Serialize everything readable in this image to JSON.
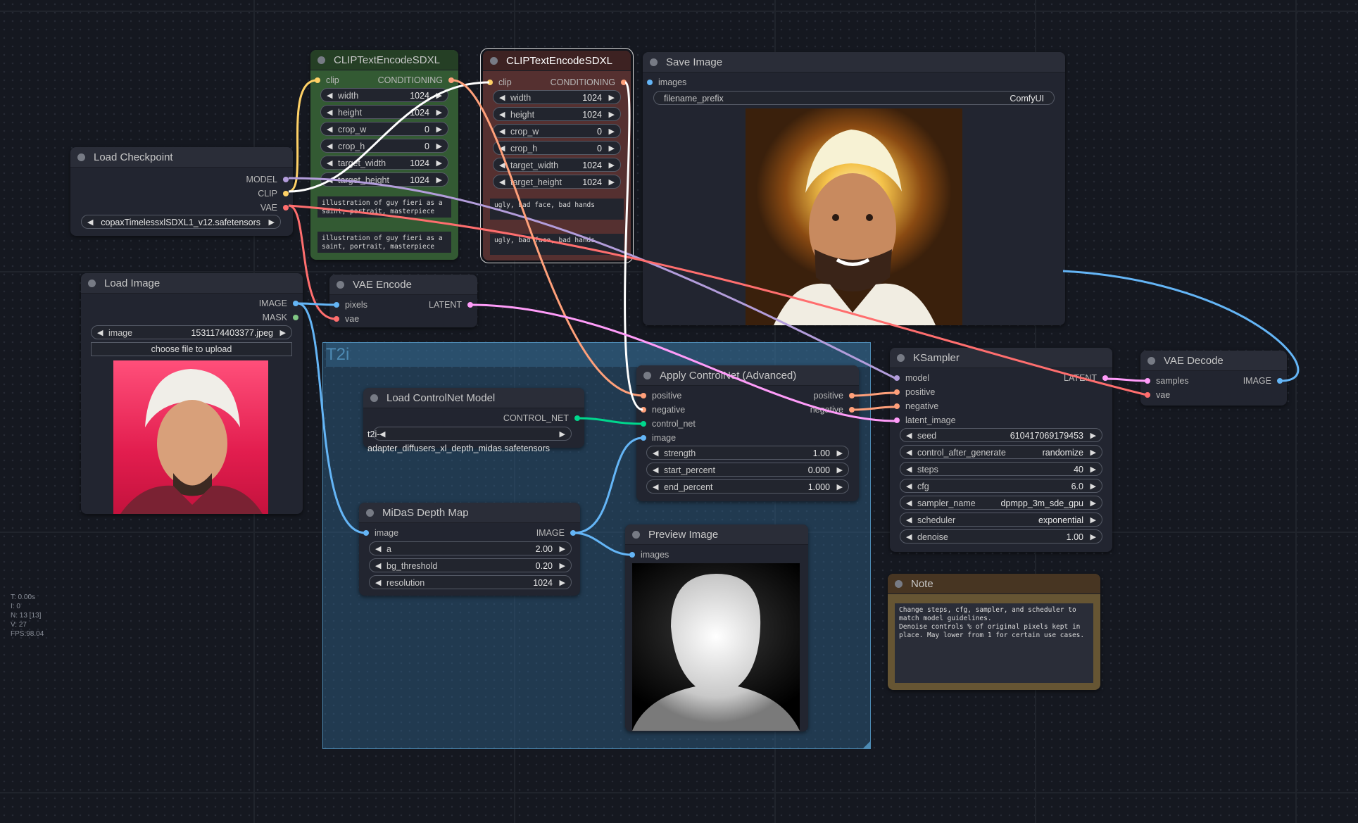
{
  "colors": {
    "model": "#b39ddb",
    "clip": "#ffd166",
    "vae": "#ff6e6e",
    "conditioning": "#ffa07a",
    "latent": "#ff9cf9",
    "image": "#64b5f6",
    "mask": "#81c784",
    "control_net": "#00d78d"
  },
  "stats": {
    "t": "T: 0.00s",
    "i": "I: 0",
    "n": "N: 13 [13]",
    "v": "V: 27",
    "fps": "FPS:98.04"
  },
  "group": {
    "title": "T2i"
  },
  "load_checkpoint": {
    "title": "Load Checkpoint",
    "outputs": [
      "MODEL",
      "CLIP",
      "VAE"
    ],
    "widget": {
      "name": "ckpt_name",
      "value": "copaxTimelessxlSDXL1_v12.safetensors"
    }
  },
  "clip_pos": {
    "title": "CLIPTextEncodeSDXL",
    "input": "clip",
    "output": "CONDITIONING",
    "widgets": [
      {
        "name": "width",
        "value": "1024"
      },
      {
        "name": "height",
        "value": "1024"
      },
      {
        "name": "crop_w",
        "value": "0"
      },
      {
        "name": "crop_h",
        "value": "0"
      },
      {
        "name": "target_width",
        "value": "1024"
      },
      {
        "name": "target_height",
        "value": "1024"
      }
    ],
    "text_g": "illustration of guy fieri as a saint, portrait, masterpiece",
    "text_l": "illustration of guy fieri as a saint, portrait, masterpiece"
  },
  "clip_neg": {
    "title": "CLIPTextEncodeSDXL",
    "input": "clip",
    "output": "CONDITIONING",
    "widgets": [
      {
        "name": "width",
        "value": "1024"
      },
      {
        "name": "height",
        "value": "1024"
      },
      {
        "name": "crop_w",
        "value": "0"
      },
      {
        "name": "crop_h",
        "value": "0"
      },
      {
        "name": "target_width",
        "value": "1024"
      },
      {
        "name": "target_height",
        "value": "1024"
      }
    ],
    "text_g": "ugly, bad face, bad hands",
    "text_l": "ugly, bad face, bad hands"
  },
  "save_image": {
    "title": "Save Image",
    "input": "images",
    "widget": {
      "name": "filename_prefix",
      "value": "ComfyUI"
    }
  },
  "load_image": {
    "title": "Load Image",
    "outputs": [
      "IMAGE",
      "MASK"
    ],
    "widget": {
      "name": "image",
      "value": "1531174403377.jpeg"
    },
    "upload_label": "choose file to upload"
  },
  "vae_encode": {
    "title": "VAE Encode",
    "inputs": [
      "pixels",
      "vae"
    ],
    "output": "LATENT"
  },
  "load_controlnet": {
    "title": "Load ControlNet Model",
    "output": "CONTROL_NET",
    "widget": {
      "name": "control_net_name",
      "value": "t2i-adapter_diffusers_xl_depth_midas.safetensors"
    }
  },
  "apply_controlnet": {
    "title": "Apply ControlNet (Advanced)",
    "inputs": [
      "positive",
      "negative",
      "control_net",
      "image"
    ],
    "outputs": [
      "positive",
      "negative"
    ],
    "widgets": [
      {
        "name": "strength",
        "value": "1.00"
      },
      {
        "name": "start_percent",
        "value": "0.000"
      },
      {
        "name": "end_percent",
        "value": "1.000"
      }
    ]
  },
  "midas": {
    "title": "MiDaS Depth Map",
    "input": "image",
    "output": "IMAGE",
    "widgets": [
      {
        "name": "a",
        "value": "2.00"
      },
      {
        "name": "bg_threshold",
        "value": "0.20"
      },
      {
        "name": "resolution",
        "value": "1024"
      }
    ]
  },
  "preview_image": {
    "title": "Preview Image",
    "input": "images"
  },
  "ksampler": {
    "title": "KSampler",
    "inputs": [
      "model",
      "positive",
      "negative",
      "latent_image"
    ],
    "output": "LATENT",
    "widgets": [
      {
        "name": "seed",
        "value": "610417069179453"
      },
      {
        "name": "control_after_generate",
        "value": "randomize"
      },
      {
        "name": "steps",
        "value": "40"
      },
      {
        "name": "cfg",
        "value": "6.0"
      },
      {
        "name": "sampler_name",
        "value": "dpmpp_3m_sde_gpu"
      },
      {
        "name": "scheduler",
        "value": "exponential"
      },
      {
        "name": "denoise",
        "value": "1.00"
      }
    ]
  },
  "vae_decode": {
    "title": "VAE Decode",
    "inputs": [
      "samples",
      "vae"
    ],
    "output": "IMAGE"
  },
  "note": {
    "title": "Note",
    "text": "Change steps, cfg, sampler, and scheduler to match model guidelines.\nDenoise controls % of original pixels kept in place. May lower from 1 for certain use cases."
  }
}
